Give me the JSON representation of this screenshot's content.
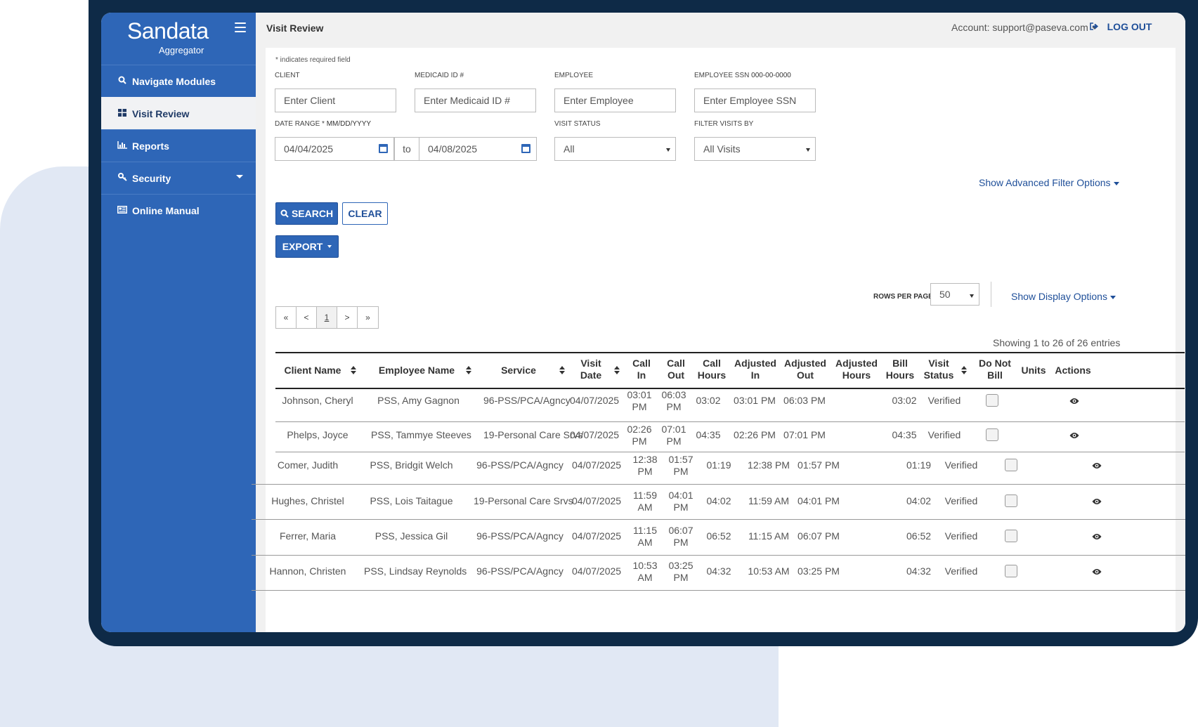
{
  "brand": {
    "name": "Sandata",
    "sub": "Aggregator"
  },
  "sidebar": {
    "items": [
      {
        "label": "Navigate Modules",
        "icon": "search-icon"
      },
      {
        "label": "Visit Review",
        "icon": "grid-icon"
      },
      {
        "label": "Reports",
        "icon": "bar-chart-icon"
      },
      {
        "label": "Security",
        "icon": "key-icon"
      },
      {
        "label": "Online Manual",
        "icon": "newspaper-icon"
      }
    ]
  },
  "header": {
    "title": "Visit Review",
    "account": "Account: support@paseva.com",
    "logout": "LOG OUT"
  },
  "form": {
    "required_note": "* indicates required field",
    "client_label": "CLIENT",
    "client_placeholder": "Enter Client",
    "medicaid_label": "MEDICAID ID #",
    "medicaid_placeholder": "Enter Medicaid ID #",
    "employee_label": "EMPLOYEE",
    "employee_placeholder": "Enter Employee",
    "ssn_label": "EMPLOYEE SSN",
    "ssn_format": "000-00-0000",
    "ssn_placeholder": "Enter Employee SSN",
    "date_label": "DATE RANGE *",
    "date_format": "MM/DD/YYYY",
    "date_from": "04/04/2025",
    "date_to_word": "to",
    "date_to": "04/08/2025",
    "status_label": "VISIT STATUS",
    "status_value": "All",
    "filter_label": "FILTER VISITS BY",
    "filter_value": "All Visits",
    "advanced": "Show Advanced Filter Options",
    "search": "SEARCH",
    "clear": "CLEAR",
    "export": "EXPORT"
  },
  "table_controls": {
    "rows_label": "ROWS PER PAGE:",
    "rows_value": "50",
    "display_options": "Show Display Options",
    "pager": [
      "«",
      "<",
      "1",
      ">",
      "»"
    ],
    "showing": "Showing 1 to 26 of 26 entries"
  },
  "columns": {
    "client": "Client Name",
    "employee": "Employee Name",
    "service": "Service",
    "visit_date_1": "Visit",
    "visit_date_2": "Date",
    "call_in_1": "Call",
    "call_in_2": "In",
    "call_out_1": "Call",
    "call_out_2": "Out",
    "call_hours_1": "Call",
    "call_hours_2": "Hours",
    "adj_in_1": "Adjusted",
    "adj_in_2": "In",
    "adj_out_1": "Adjusted",
    "adj_out_2": "Out",
    "adj_hours_1": "Adjusted",
    "adj_hours_2": "Hours",
    "bill_hours_1": "Bill",
    "bill_hours_2": "Hours",
    "visit_status_1": "Visit",
    "visit_status_2": "Status",
    "dnb_1": "Do Not",
    "dnb_2": "Bill",
    "units": "Units",
    "actions": "Actions"
  },
  "rows": [
    {
      "client": "Johnson, Cheryl",
      "employee": "PSS, Amy Gagnon",
      "service": "96-PSS/PCA/Agncy",
      "date": "04/07/2025",
      "in_t": "03:01",
      "in_p": "PM",
      "out_t": "06:03",
      "out_p": "PM",
      "call_hours": "03:02",
      "adj_in": "03:01 PM",
      "adj_out": "06:03 PM",
      "bill": "03:02",
      "status": "Verified"
    },
    {
      "client": "Phelps, Joyce",
      "employee": "PSS, Tammye Steeves",
      "service": "19-Personal Care Srvs",
      "date": "04/07/2025",
      "in_t": "02:26",
      "in_p": "PM",
      "out_t": "07:01",
      "out_p": "PM",
      "call_hours": "04:35",
      "adj_in": "02:26 PM",
      "adj_out": "07:01 PM",
      "bill": "04:35",
      "status": "Verified"
    },
    {
      "client": "Comer, Judith",
      "employee": "PSS, Bridgit Welch",
      "service": "96-PSS/PCA/Agncy",
      "date": "04/07/2025",
      "in_t": "12:38",
      "in_p": "PM",
      "out_t": "01:57",
      "out_p": "PM",
      "call_hours": "01:19",
      "adj_in": "12:38 PM",
      "adj_out": "01:57 PM",
      "bill": "01:19",
      "status": "Verified"
    },
    {
      "client": "Hughes, Christel",
      "employee": "PSS, Lois Taitague",
      "service": "19-Personal Care Srvs",
      "date": "04/07/2025",
      "in_t": "11:59",
      "in_p": "AM",
      "out_t": "04:01",
      "out_p": "PM",
      "call_hours": "04:02",
      "adj_in": "11:59 AM",
      "adj_out": "04:01 PM",
      "bill": "04:02",
      "status": "Verified"
    },
    {
      "client": "Ferrer, Maria",
      "employee": "PSS, Jessica Gil",
      "service": "96-PSS/PCA/Agncy",
      "date": "04/07/2025",
      "in_t": "11:15",
      "in_p": "AM",
      "out_t": "06:07",
      "out_p": "PM",
      "call_hours": "06:52",
      "adj_in": "11:15 AM",
      "adj_out": "06:07 PM",
      "bill": "06:52",
      "status": "Verified"
    },
    {
      "client": "Hannon, Christen",
      "employee": "PSS, Lindsay Reynolds",
      "service": "96-PSS/PCA/Agncy",
      "date": "04/07/2025",
      "in_t": "10:53",
      "in_p": "AM",
      "out_t": "03:25",
      "out_p": "PM",
      "call_hours": "04:32",
      "adj_in": "10:53 AM",
      "adj_out": "03:25 PM",
      "bill": "04:32",
      "status": "Verified"
    }
  ],
  "colors": {
    "sidebar": "#2e66b7",
    "frame": "#0e2a47",
    "link": "#1f4f99",
    "backdrop": "#e1e8f4"
  }
}
